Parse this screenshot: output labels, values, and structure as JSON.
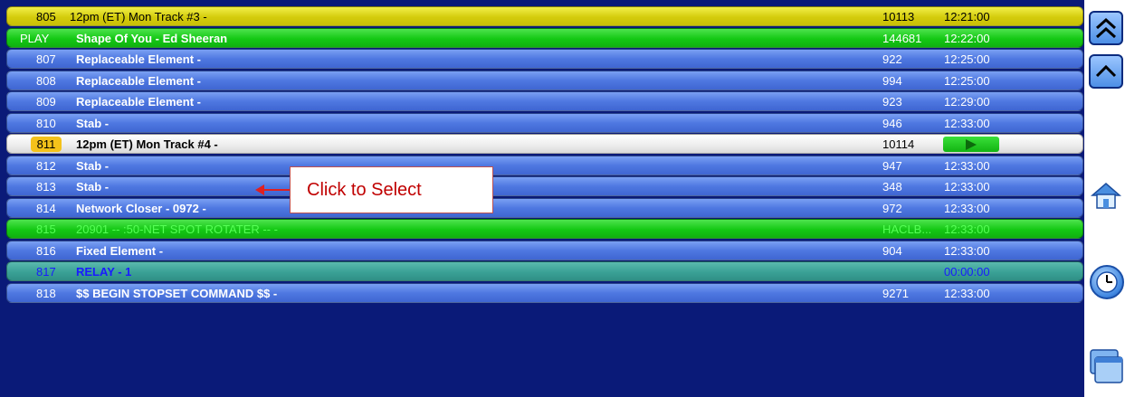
{
  "rows": [
    {
      "num": "805",
      "title": "12pm (ET) Mon Track #3 -",
      "cut": "10113",
      "time": "12:21:00",
      "style": "yellow"
    },
    {
      "num": "PLAY",
      "title": "Shape Of You - Ed Sheeran",
      "cut": "144681",
      "time": "12:22:00",
      "style": "green"
    },
    {
      "num": "807",
      "title": "Replaceable Element -",
      "cut": "922",
      "time": "12:25:00",
      "style": "blue"
    },
    {
      "num": "808",
      "title": "Replaceable Element -",
      "cut": "994",
      "time": "12:25:00",
      "style": "blue"
    },
    {
      "num": "809",
      "title": "Replaceable Element -",
      "cut": "923",
      "time": "12:29:00",
      "style": "blue"
    },
    {
      "num": "810",
      "title": "Stab -",
      "cut": "946",
      "time": "12:33:00",
      "style": "blue"
    },
    {
      "num": "811",
      "title": "12pm (ET) Mon Track #4 -",
      "cut": "10114",
      "time": "",
      "style": "white"
    },
    {
      "num": "812",
      "title": "Stab -",
      "cut": "947",
      "time": "12:33:00",
      "style": "blue"
    },
    {
      "num": "813",
      "title": "Stab -",
      "cut": "348",
      "time": "12:33:00",
      "style": "blue"
    },
    {
      "num": "814",
      "title": "Network Closer - 0972 -",
      "cut": "972",
      "time": "12:33:00",
      "style": "blue"
    },
    {
      "num": "815",
      "title": "20901 -- :50-NET SPOT ROTATER -- -",
      "cut": "HACLB...",
      "time": "12:33:00",
      "style": "green disabled"
    },
    {
      "num": "816",
      "title": "Fixed Element -",
      "cut": "904",
      "time": "12:33:00",
      "style": "blue"
    },
    {
      "num": "817",
      "title": "RELAY - 1",
      "cut": "",
      "time": "00:00:00",
      "style": "teal relay"
    },
    {
      "num": "818",
      "title": "$$ BEGIN STOPSET COMMAND $$ -",
      "cut": "9271",
      "time": "12:33:00",
      "style": "blue"
    }
  ],
  "callout": {
    "text": "Click to Select"
  },
  "side_buttons": [
    {
      "name": "page-up-icon",
      "glyph": "double-chevron-up"
    },
    {
      "name": "scroll-up-icon",
      "glyph": "chevron-up"
    },
    {
      "name": "home-icon",
      "glyph": "house"
    },
    {
      "name": "clock-icon",
      "glyph": "clock"
    },
    {
      "name": "windows-icon",
      "glyph": "stacked-windows"
    }
  ]
}
